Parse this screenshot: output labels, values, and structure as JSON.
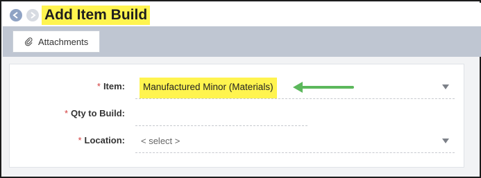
{
  "header": {
    "title": "Add Item Build",
    "back_icon": "arrow-left-icon",
    "forward_icon": "arrow-right-icon"
  },
  "tabs": [
    {
      "label": "Attachments",
      "icon": "paperclip-icon"
    }
  ],
  "form": {
    "item": {
      "label": "Item:",
      "required": "*",
      "value": "Manufactured Minor (Materials)"
    },
    "qty": {
      "label": "Qty to Build:",
      "required": "*",
      "value": ""
    },
    "location": {
      "label": "Location:",
      "required": "*",
      "placeholder": "< select >"
    }
  },
  "colors": {
    "highlight": "#fff44f",
    "required": "#d23b3b",
    "arrow": "#5cb85c",
    "tabbar": "#bfc6d2"
  }
}
